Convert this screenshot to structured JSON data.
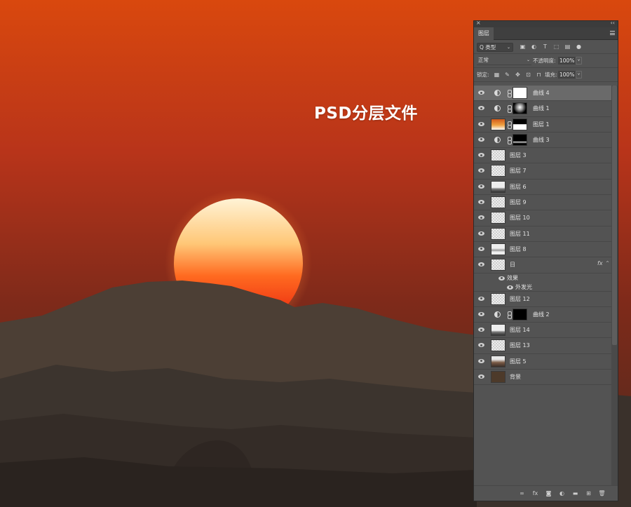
{
  "caption": "PSD分层文件",
  "panel": {
    "close_glyph": "×",
    "collapse_glyph": "‹‹",
    "tab_label": "图层",
    "filter": {
      "kind_label": "Q 类型",
      "chevron": "⌄"
    },
    "blend": {
      "mode": "正常",
      "chevron": "⌄",
      "opacity_label": "不透明度:",
      "opacity_value": "100%"
    },
    "lock": {
      "label": "锁定:",
      "fill_label": "填充:",
      "fill_value": "100%"
    },
    "filter_icons": [
      "image-filter-icon",
      "adjustment-filter-icon",
      "type-filter-icon",
      "shape-filter-icon",
      "smart-object-filter-icon",
      "filter-toggle-icon"
    ],
    "lock_icons": [
      "lock-transparent-icon",
      "lock-image-icon",
      "lock-position-icon",
      "lock-artboard-icon",
      "lock-all-icon"
    ],
    "bottom_icons": [
      "link-layers-icon",
      "fx-icon",
      "add-mask-icon",
      "new-adjustment-icon",
      "new-group-icon",
      "new-layer-icon",
      "delete-layer-icon"
    ]
  },
  "layers": [
    {
      "name": "曲线 4",
      "kind": "adjustment",
      "mask": "white",
      "selected": true
    },
    {
      "name": "曲线 1",
      "kind": "adjustment",
      "mask": "radial"
    },
    {
      "name": "图层 1",
      "kind": "pixel-mask",
      "content": "orange",
      "mask": "split"
    },
    {
      "name": "曲线 3",
      "kind": "adjustment",
      "mask": "black-hill"
    },
    {
      "name": "图层 3",
      "kind": "pixel",
      "content": "checker"
    },
    {
      "name": "图层 7",
      "kind": "pixel",
      "content": "checker"
    },
    {
      "name": "图层 6",
      "kind": "pixel",
      "content": "hill"
    },
    {
      "name": "图层 9",
      "kind": "pixel",
      "content": "checker"
    },
    {
      "name": "图层 10",
      "kind": "pixel",
      "content": "checker"
    },
    {
      "name": "图层 11",
      "kind": "pixel",
      "content": "checker"
    },
    {
      "name": "图层 8",
      "kind": "pixel",
      "content": "hill2"
    },
    {
      "name": "日",
      "kind": "pixel",
      "content": "checker",
      "fx": "fx",
      "effects_label": "效果",
      "effect": "外发光"
    },
    {
      "name": "图层 12",
      "kind": "pixel",
      "content": "checker"
    },
    {
      "name": "曲线 2",
      "kind": "adjustment",
      "mask": "black"
    },
    {
      "name": "图层 14",
      "kind": "pixel",
      "content": "hill"
    },
    {
      "name": "图层 13",
      "kind": "pixel",
      "content": "checker"
    },
    {
      "name": "图层 5",
      "kind": "pixel",
      "content": "brown"
    },
    {
      "name": "背景",
      "kind": "pixel",
      "content": "bg"
    }
  ]
}
